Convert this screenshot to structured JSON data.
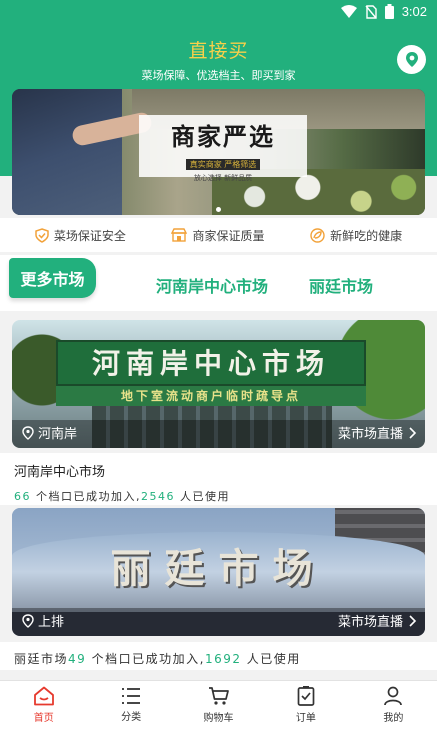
{
  "status_bar": {
    "time": "3:02",
    "icons": [
      "wifi-icon",
      "no-sim-icon",
      "battery-icon"
    ]
  },
  "header": {
    "title": "直接买",
    "subtitle": "菜场保障、优选档主、即买到家",
    "location_icon": "location-pin-icon",
    "title_color": "#f7d04a",
    "brand_color": "#22b07d"
  },
  "banner": {
    "headline": "商家严选",
    "tagline": "真实商家 严格筛选",
    "footer": "放心选择    新鲜品质"
  },
  "guarantees": [
    {
      "icon": "shield-check-icon",
      "label": "菜场保证安全"
    },
    {
      "icon": "store-icon",
      "label": "商家保证质量"
    },
    {
      "icon": "fresh-leaf-icon",
      "label": "新鲜吃的健康"
    }
  ],
  "market_tabs": {
    "more": "更多市场",
    "tabs": [
      "河南岸中心市场",
      "丽廷市场"
    ]
  },
  "markets": [
    {
      "photo_sign": "河南岸中心市场",
      "photo_sub_sign": "地下室流动商户临时疏导点",
      "location": "河南岸",
      "live_label": "菜市场直播",
      "name": "河南岸中心市场",
      "stall_count": "66",
      "stat_text_1": " 个档口已成功加入,",
      "user_count": "2546",
      "stat_text_2": " 人已使用"
    },
    {
      "photo_sign": "丽廷市场",
      "location": "上排",
      "live_label": "菜市场直播",
      "name": "丽廷市场",
      "stall_count": "49",
      "stat_text_1": " 个档口已成功加入,",
      "user_count": "1692",
      "stat_text_2": " 人已使用"
    }
  ],
  "bottom_nav": [
    {
      "icon": "home-icon",
      "label": "首页",
      "active": true
    },
    {
      "icon": "category-list-icon",
      "label": "分类",
      "active": false
    },
    {
      "icon": "cart-icon",
      "label": "购物车",
      "active": false
    },
    {
      "icon": "order-icon",
      "label": "订单",
      "active": false
    },
    {
      "icon": "profile-icon",
      "label": "我的",
      "active": false
    }
  ]
}
